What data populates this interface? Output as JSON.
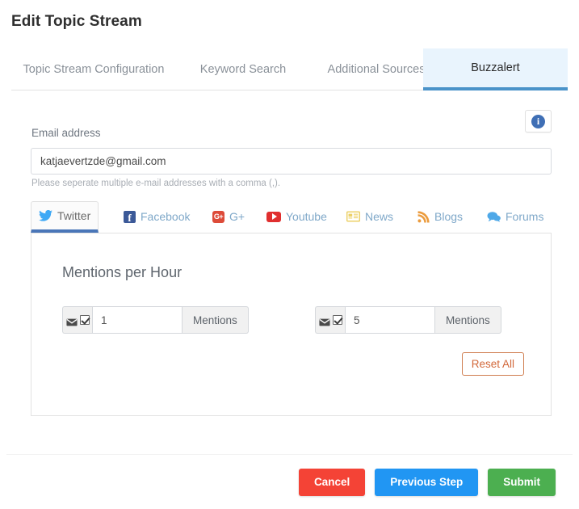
{
  "page_title": "Edit Topic Stream",
  "tabs": [
    {
      "label": "Topic Stream Configuration",
      "active": false
    },
    {
      "label": "Keyword Search",
      "active": false
    },
    {
      "label": "Additional Sources",
      "active": false
    },
    {
      "label": "Buzzalert",
      "active": true
    }
  ],
  "info_button": {
    "icon": "info-icon",
    "glyph": "i"
  },
  "email": {
    "label": "Email address",
    "value": "katjaevertzde@gmail.com",
    "placeholder": "Email address",
    "help": "Please seperate multiple e-mail addresses with a comma (,)."
  },
  "source_tabs": [
    {
      "label": "Twitter",
      "icon": "twitter-icon",
      "active": true
    },
    {
      "label": "Facebook",
      "icon": "facebook-icon",
      "active": false
    },
    {
      "label": "G+",
      "icon": "google-plus-icon",
      "glyph": "G+",
      "active": false
    },
    {
      "label": "Youtube",
      "icon": "youtube-icon",
      "active": false
    },
    {
      "label": "News",
      "icon": "news-icon",
      "active": false
    },
    {
      "label": "Blogs",
      "icon": "rss-icon",
      "active": false
    },
    {
      "label": "Forums",
      "icon": "forum-icon",
      "active": false
    }
  ],
  "panel": {
    "title": "Mentions per Hour",
    "alerts": [
      {
        "email_icon": "envelope-icon",
        "checked": true,
        "value": "1",
        "unit": "Mentions"
      },
      {
        "email_icon": "envelope-icon",
        "checked": true,
        "value": "5",
        "unit": "Mentions"
      }
    ],
    "reset_label": "Reset All"
  },
  "footer": {
    "cancel_label": "Cancel",
    "previous_label": "Previous Step",
    "submit_label": "Submit"
  },
  "colors": {
    "active_tab_bg": "#e9f4fd",
    "active_tab_border": "#4a93c9",
    "cancel": "#f44336",
    "previous": "#2196f3",
    "submit": "#4caf50",
    "reset_border": "#cf7d4f",
    "reset_text": "#d2683a",
    "twitter": "#3fa9f5",
    "facebook": "#3b5998",
    "gplus": "#dd4b39",
    "youtube": "#e02f2f",
    "news": "#f0d264",
    "blogs": "#eb9b3d",
    "forums": "#4ea8e8",
    "info": "#3f6fb5"
  }
}
